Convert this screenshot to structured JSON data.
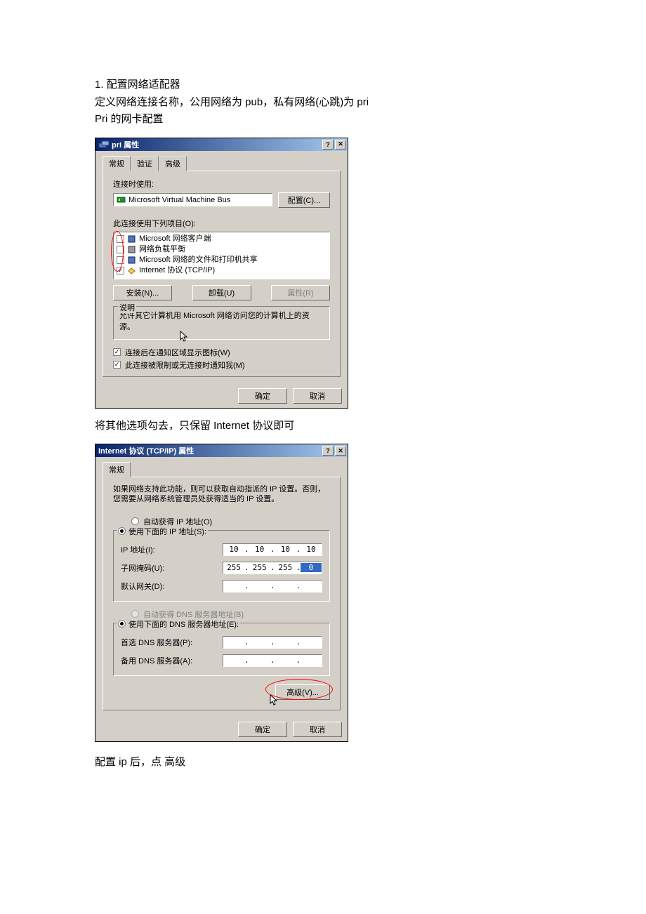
{
  "doc": {
    "line1": "1.   配置网络适配器",
    "line2": "定义网络连接名称，公用网络为 pub，私有网络(心跳)为 pri",
    "line3": "Pri 的网卡配置",
    "line4": "将其他选项勾去，只保留 Internet  协议即可",
    "line5": "配置 ip 后，点  高级"
  },
  "dlg1": {
    "title_prefix": "pri ",
    "title": "属性",
    "tabs": {
      "general": "常规",
      "auth": "验证",
      "advanced": "高级"
    },
    "connect_using": "连接时使用:",
    "device": "Microsoft Virtual Machine Bus",
    "configure_btn": "配置(C)...",
    "this_conn_uses": "此连接使用下列项目(O):",
    "items": [
      {
        "checked": false,
        "label": "Microsoft 网络客户端"
      },
      {
        "checked": false,
        "label": "网络负载平衡"
      },
      {
        "checked": false,
        "label": "Microsoft 网络的文件和打印机共享"
      },
      {
        "checked": true,
        "label": "Internet 协议 (TCP/IP)"
      }
    ],
    "install_btn": "安装(N)...",
    "uninstall_btn": "卸载(U)",
    "props_btn": "属性(R)",
    "desc_head": "说明",
    "desc_text": "允许其它计算机用 Microsoft 网络访问您的计算机上的资源。",
    "show_icon_chk": "连接后在通知区域显示图标(W)",
    "limited_chk": "此连接被限制或无连接时通知我(M)",
    "ok": "确定",
    "cancel": "取消"
  },
  "dlg2": {
    "title": "Internet 协议 (TCP/IP) 属性",
    "tab_general": "常规",
    "info": "如果网络支持此功能，则可以获取自动指派的 IP 设置。否则，您需要从网络系统管理员处获得适当的 IP 设置。",
    "radio_auto_ip": "自动获得 IP 地址(O)",
    "radio_use_ip": "使用下面的 IP 地址(S):",
    "ip_label": "IP 地址(I):",
    "ip": [
      "10",
      "10",
      "10",
      "10"
    ],
    "mask_label": "子网掩码(U):",
    "mask": [
      "255",
      "255",
      "255",
      "0"
    ],
    "gateway_label": "默认网关(D):",
    "gateway": [
      "",
      "",
      "",
      ""
    ],
    "radio_auto_dns": "自动获得 DNS 服务器地址(B)",
    "radio_use_dns": "使用下面的 DNS 服务器地址(E):",
    "pref_dns_label": "首选 DNS 服务器(P):",
    "pref_dns": [
      "",
      "",
      "",
      ""
    ],
    "alt_dns_label": "备用 DNS 服务器(A):",
    "alt_dns": [
      "",
      "",
      "",
      ""
    ],
    "advanced_btn": "高级(V)...",
    "ok": "确定",
    "cancel": "取消"
  }
}
